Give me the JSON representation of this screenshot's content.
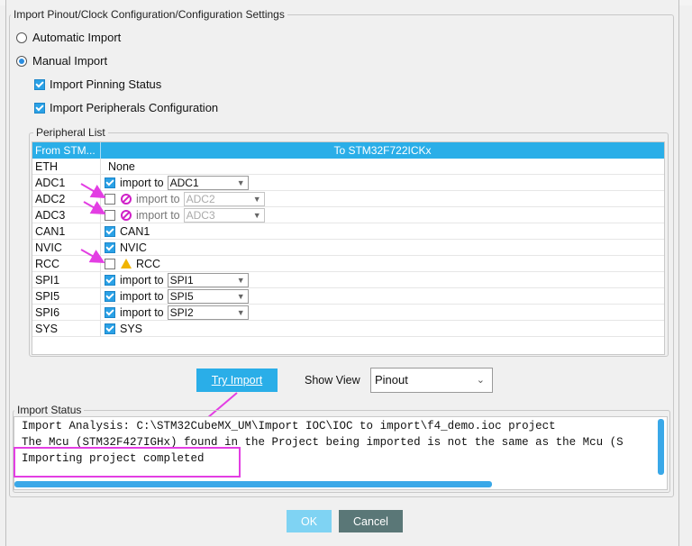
{
  "group_title": "Import Pinout/Clock Configuration/Configuration Settings",
  "options": {
    "automatic": "Automatic Import",
    "manual": "Manual Import",
    "pinning": "Import Pinning Status",
    "peripherals": "Import Peripherals Configuration"
  },
  "peripheral_list": {
    "title": "Peripheral List",
    "col_from": "From STM...",
    "col_to": "To STM32F722ICKx",
    "rows": [
      {
        "name": "ETH",
        "text": "None"
      },
      {
        "name": "ADC1",
        "text": "import to",
        "select": "ADC1"
      },
      {
        "name": "ADC2",
        "text": "import to",
        "select": "ADC2"
      },
      {
        "name": "ADC3",
        "text": "import to",
        "select": "ADC3"
      },
      {
        "name": "CAN1",
        "text": "CAN1"
      },
      {
        "name": "NVIC",
        "text": "NVIC"
      },
      {
        "name": "RCC",
        "text": "RCC"
      },
      {
        "name": "SPI1",
        "text": "import to",
        "select": "SPI1"
      },
      {
        "name": "SPI5",
        "text": "import to",
        "select": "SPI5"
      },
      {
        "name": "SPI6",
        "text": "import to",
        "select": "SPI2"
      },
      {
        "name": "SYS",
        "text": "SYS"
      }
    ]
  },
  "try_import": "Try Import",
  "show_view": {
    "label": "Show View",
    "value": "Pinout"
  },
  "import_status": {
    "title": "Import Status",
    "lines": [
      "Import Analysis: C:\\STM32CubeMX_UM\\Import IOC\\IOC to import\\f4_demo.ioc project",
      "The Mcu (STM32F427IGHx) found in the Project being imported is not the same as the Mcu (S",
      "Importing project completed"
    ]
  },
  "buttons": {
    "ok": "OK",
    "cancel": "Cancel"
  },
  "colors": {
    "accent": "#2aaee8",
    "annotation": "#e33ee3"
  }
}
